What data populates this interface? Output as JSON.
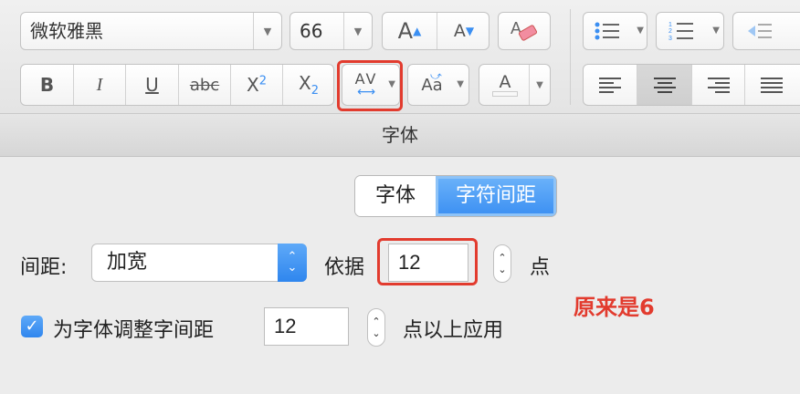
{
  "toolbar": {
    "font_name": "微软雅黑",
    "font_size": "66",
    "grow_font_label": "A",
    "shrink_font_label": "A",
    "bold_label": "B",
    "italic_label": "I",
    "underline_label": "U",
    "strike_label": "abc",
    "superscript_label": "X",
    "superscript_sup": "2",
    "subscript_label": "X",
    "subscript_sub": "2",
    "spacing_label": "AV",
    "case_label": "Aa",
    "color_label": "A"
  },
  "dialog": {
    "title": "字体",
    "tabs": [
      {
        "label": "字体",
        "active": false
      },
      {
        "label": "字符间距",
        "active": true
      }
    ],
    "spacing_label": "间距:",
    "spacing_value": "加宽",
    "by_label": "依据",
    "by_value": "12",
    "points_label": "点",
    "annotation": "原来是6",
    "kerning_checked": true,
    "kerning_label": "为字体调整字间距",
    "kerning_value": "12",
    "kerning_suffix": "点以上应用"
  },
  "colors": {
    "accent": "#3b8ff2",
    "highlight_red": "#e23b2e"
  }
}
